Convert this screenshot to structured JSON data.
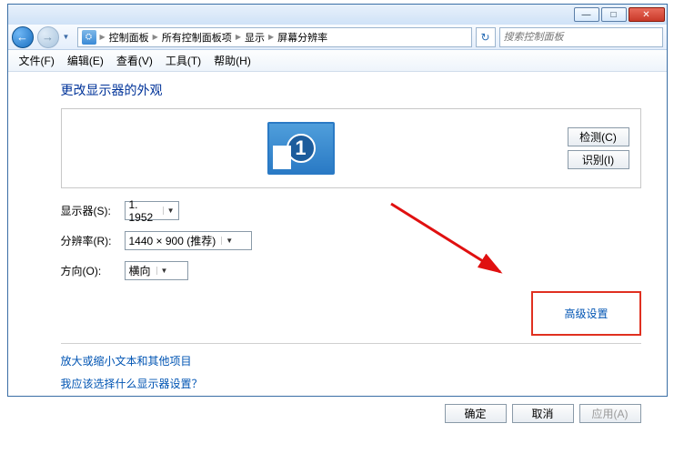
{
  "titlebar": {
    "min": "—",
    "max": "□",
    "close": "✕"
  },
  "nav": {
    "back_glyph": "←",
    "fwd_glyph": "→",
    "refresh_glyph": "↻"
  },
  "breadcrumb": {
    "root": "控制面板",
    "level1": "所有控制面板项",
    "level2": "显示",
    "level3": "屏幕分辨率"
  },
  "search": {
    "placeholder": "搜索控制面板"
  },
  "menubar": {
    "file": "文件(F)",
    "edit": "编辑(E)",
    "view": "查看(V)",
    "tools": "工具(T)",
    "help": "帮助(H)"
  },
  "heading": "更改显示器的外观",
  "buttons": {
    "detect": "检测(C)",
    "identify": "识别(I)",
    "ok": "确定",
    "cancel": "取消",
    "apply": "应用(A)"
  },
  "form": {
    "display_label": "显示器(S):",
    "display_value": "1. 1952",
    "resolution_label": "分辨率(R):",
    "resolution_value": "1440 × 900 (推荐)",
    "orientation_label": "方向(O):",
    "orientation_value": "横向"
  },
  "advanced_link": "高级设置",
  "link1": "放大或缩小文本和其他项目",
  "link2": "我应该选择什么显示器设置？"
}
